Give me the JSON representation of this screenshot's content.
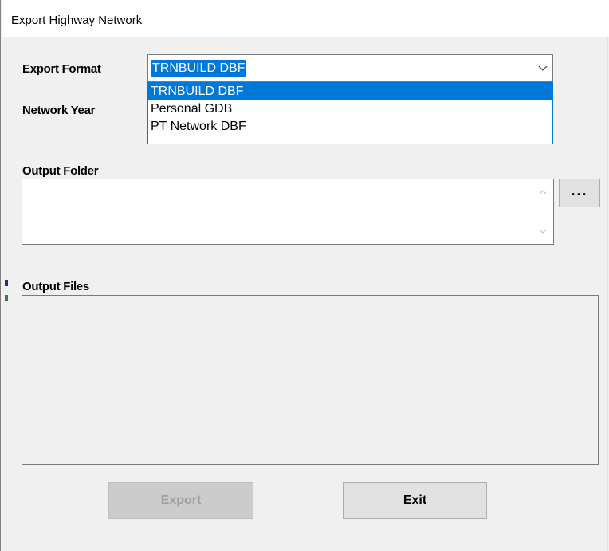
{
  "window": {
    "title": "Export Highway Network"
  },
  "labels": {
    "export_format": "Export Format",
    "network_year": "Network Year",
    "output_folder": "Output Folder",
    "output_files": "Output Files"
  },
  "export_format": {
    "selected": "TRNBUILD DBF",
    "options": [
      "TRNBUILD DBF",
      "Personal GDB",
      "PT Network DBF"
    ],
    "expanded": true,
    "dropdown_icon": "chevron-down-icon"
  },
  "output_folder": {
    "value": "",
    "browse_label": "..."
  },
  "output_files": {
    "items": []
  },
  "buttons": {
    "export": "Export",
    "exit": "Exit"
  },
  "colors": {
    "selection": "#0078d7",
    "disabled_text": "#a0a0a0",
    "button_face": "#e1e1e1"
  }
}
